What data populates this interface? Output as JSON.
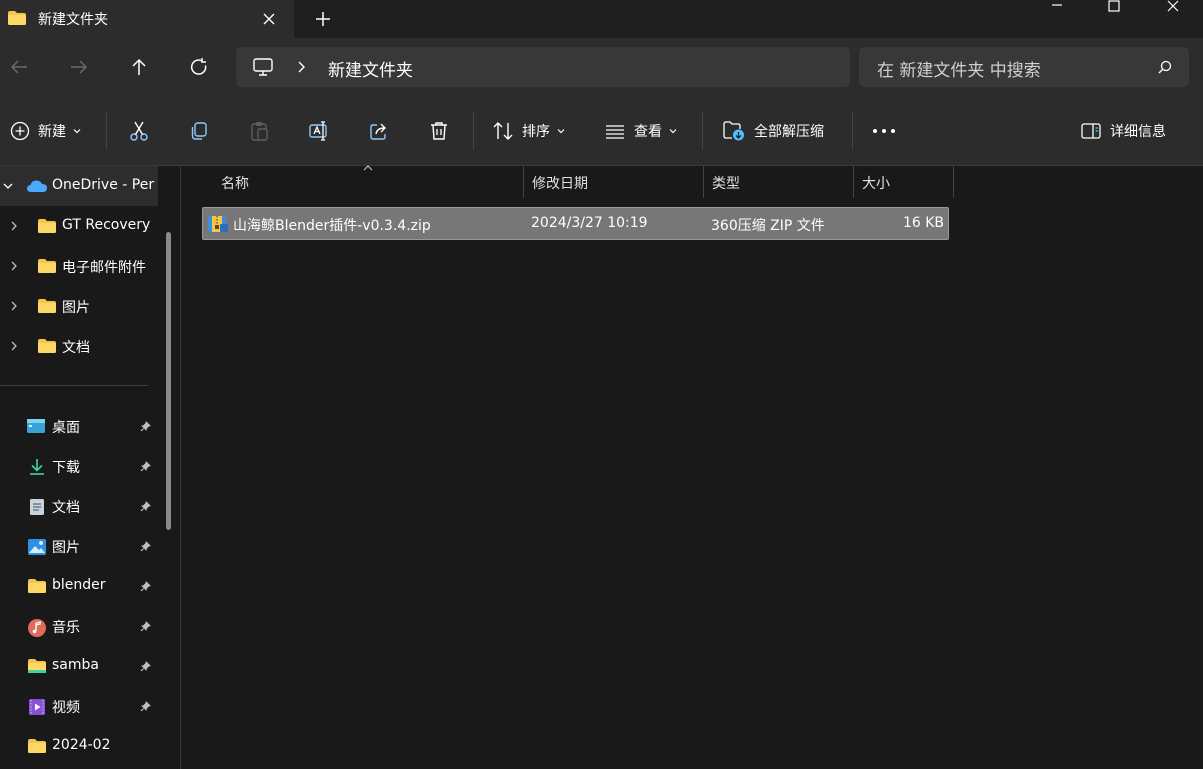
{
  "window": {
    "tab_title": "新建文件夹"
  },
  "address": {
    "crumb": "新建文件夹",
    "search_placeholder": "在 新建文件夹 中搜索"
  },
  "toolbar": {
    "new_label": "新建",
    "sort_label": "排序",
    "view_label": "查看",
    "extract_label": "全部解压缩",
    "details_label": "详细信息"
  },
  "sidebar": {
    "tree": [
      {
        "label": "OneDrive - Per"
      },
      {
        "label": "GT Recovery"
      },
      {
        "label": "电子邮件附件"
      },
      {
        "label": "图片"
      },
      {
        "label": "文档"
      }
    ],
    "quick": [
      {
        "label": "桌面",
        "icon": "desktop-icon"
      },
      {
        "label": "下载",
        "icon": "download-icon"
      },
      {
        "label": "文档",
        "icon": "documents-icon"
      },
      {
        "label": "图片",
        "icon": "pictures-icon"
      },
      {
        "label": "blender",
        "icon": "folder-icon"
      },
      {
        "label": "音乐",
        "icon": "music-icon"
      },
      {
        "label": "samba",
        "icon": "folder-icon"
      },
      {
        "label": "视频",
        "icon": "videos-icon"
      },
      {
        "label": "2024-02",
        "icon": "folder-icon"
      }
    ]
  },
  "columns": {
    "name": "名称",
    "modified": "修改日期",
    "type": "类型",
    "size": "大小"
  },
  "files": [
    {
      "name": "山海鲸Blender插件-v0.3.4.zip",
      "modified": "2024/3/27 10:19",
      "type": "360压缩 ZIP 文件",
      "size": "16 KB"
    }
  ],
  "colors": {
    "accent": "#4cc2ff",
    "folder": "#f4c54a",
    "selection": "#777777"
  }
}
